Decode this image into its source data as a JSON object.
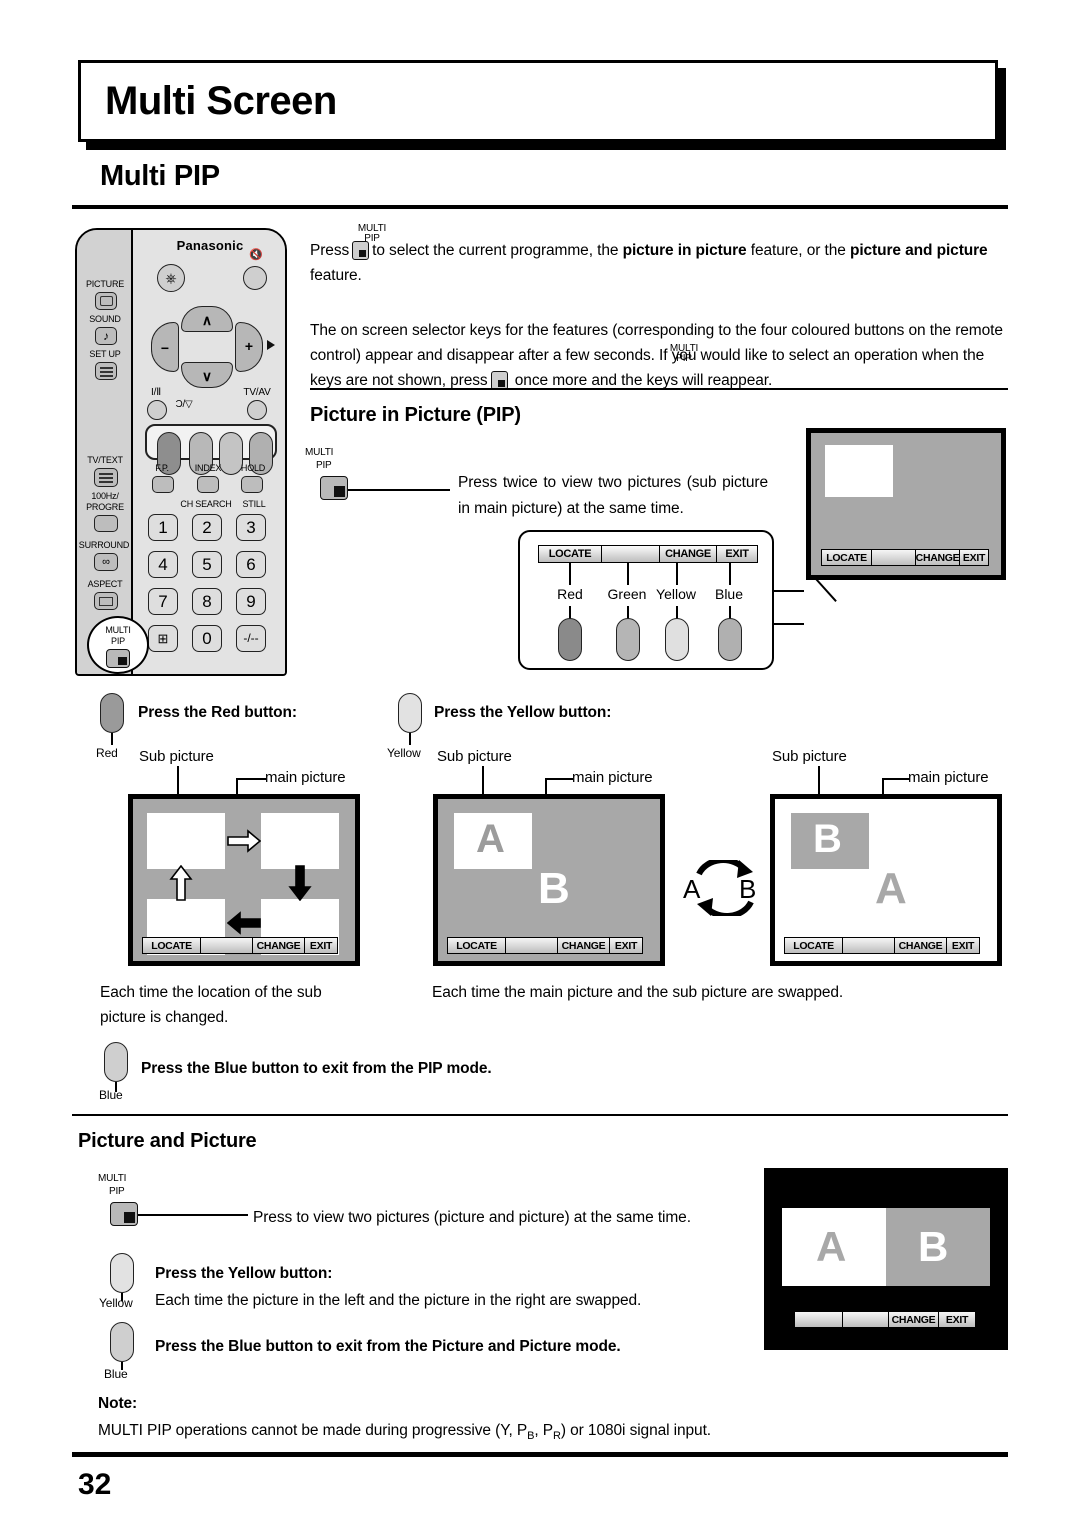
{
  "page": {
    "banner_title": "Multi Screen",
    "section_title": "Multi PIP",
    "page_number": "32"
  },
  "intro": {
    "p1_before": "Press",
    "p1_after": "to select the current programme, the ",
    "p1_bold1": "picture in picture",
    "p1_mid": " feature, or the ",
    "p1_bold2": "picture and picture",
    "p1_end": " feature.",
    "p2_a": "The on screen selector keys for the features (corresponding to the four coloured buttons on the remote control) appear and disappear after a few seconds. If you would like to select an operation when the keys are not shown, press",
    "p2_b": "once more and the keys will reappear.",
    "multi_label": "MULTI",
    "pip_label": "PIP"
  },
  "remote": {
    "brand": "Panasonic",
    "left_buttons": [
      {
        "label": "PICTURE",
        "icon": "picture-icon"
      },
      {
        "label": "SOUND",
        "icon": "note-icon"
      },
      {
        "label": "SET UP",
        "icon": "menu-icon"
      },
      {
        "label": "TV/TEXT",
        "icon": "text-icon"
      },
      {
        "label": "100Hz/\nPROGRE",
        "icon": "blank-icon"
      },
      {
        "label": "SURROUND",
        "icon": "surround-icon"
      },
      {
        "label": "ASPECT",
        "icon": "aspect-icon"
      },
      {
        "label": "MULTI\nPIP",
        "icon": "multipip-icon"
      }
    ],
    "left_labels": {
      "picture": "PICTURE",
      "sound": "SOUND",
      "setup": "SET UP",
      "tvtext": "TV/TEXT",
      "hz_line1": "100Hz/",
      "hz_line2": "PROGRE",
      "surround": "SURROUND",
      "aspect": "ASPECT",
      "multi": "MULTI",
      "pip": "PIP"
    },
    "dpad": {
      "up": "∧",
      "down": "∨",
      "left": "−",
      "right": "+"
    },
    "small_labels": {
      "i_ii": "I/Ⅱ",
      "cd": "Ɔ/▽",
      "tvav": "TV/AV",
      "fp": "F.P.",
      "index": "INDEX",
      "hold": "HOLD",
      "ch_search": "CH SEARCH",
      "still": "STILL"
    },
    "keypad": [
      "1",
      "2",
      "3",
      "4",
      "5",
      "6",
      "7",
      "8",
      "9",
      "⊞",
      "0",
      "-/--"
    ]
  },
  "pip_section": {
    "heading": "Picture in Picture (PIP)",
    "multi": "MULTI",
    "pip": "PIP",
    "desc": "Press twice to view two pictures (sub picture in main picture) at the same time.",
    "selector_keys": [
      "LOCATE",
      "",
      "CHANGE",
      "EXIT"
    ],
    "colour_names": [
      "Red",
      "Green",
      "Yellow",
      "Blue"
    ],
    "colour_hex": [
      "#8a8a8a",
      "#b5b5b5",
      "#e0e0e0",
      "#b0b0b0"
    ]
  },
  "tv_pip": {
    "osd": [
      "LOCATE",
      "",
      "CHANGE",
      "EXIT"
    ]
  },
  "red_block": {
    "button_name": "Red",
    "heading": "Press the Red button:",
    "label_sub": "Sub picture",
    "label_main": "main picture",
    "osd": [
      "LOCATE",
      "",
      "CHANGE",
      "EXIT"
    ],
    "caption": "Each time the location of the sub picture is changed."
  },
  "yellow_block": {
    "button_name": "Yellow",
    "heading": "Press the Yellow button:",
    "label_sub": "Sub picture",
    "label_main": "main picture",
    "osd": [
      "LOCATE",
      "",
      "CHANGE",
      "EXIT"
    ],
    "screen1_sub": "A",
    "screen1_main": "B",
    "swap_left": "A",
    "swap_right": "B",
    "screen2_sub": "B",
    "screen2_main": "A",
    "caption": "Each time the main picture and the sub picture are swapped."
  },
  "blue_block": {
    "button_name": "Blue",
    "heading": "Press the Blue button to exit from the PIP mode."
  },
  "pap_section": {
    "heading": "Picture and Picture",
    "multi": "MULTI",
    "pip": "PIP",
    "desc": "Press to view two pictures (picture and picture) at the same time.",
    "yellow_name": "Yellow",
    "yellow_heading": "Press the Yellow button:",
    "yellow_text": "Each time the picture in the left and the picture in the right are swapped.",
    "blue_name": "Blue",
    "blue_heading": "Press the Blue button to exit from the Picture and Picture mode.",
    "screen_left": "A",
    "screen_right": "B",
    "osd": [
      "",
      "",
      "CHANGE",
      "EXIT"
    ]
  },
  "note": {
    "title": "Note:",
    "text_a": "MULTI PIP operations cannot be made during progressive (Y, P",
    "sub_b": "B",
    "text_b": ", P",
    "sub_r": "R",
    "text_c": ") or 1080i signal input."
  }
}
